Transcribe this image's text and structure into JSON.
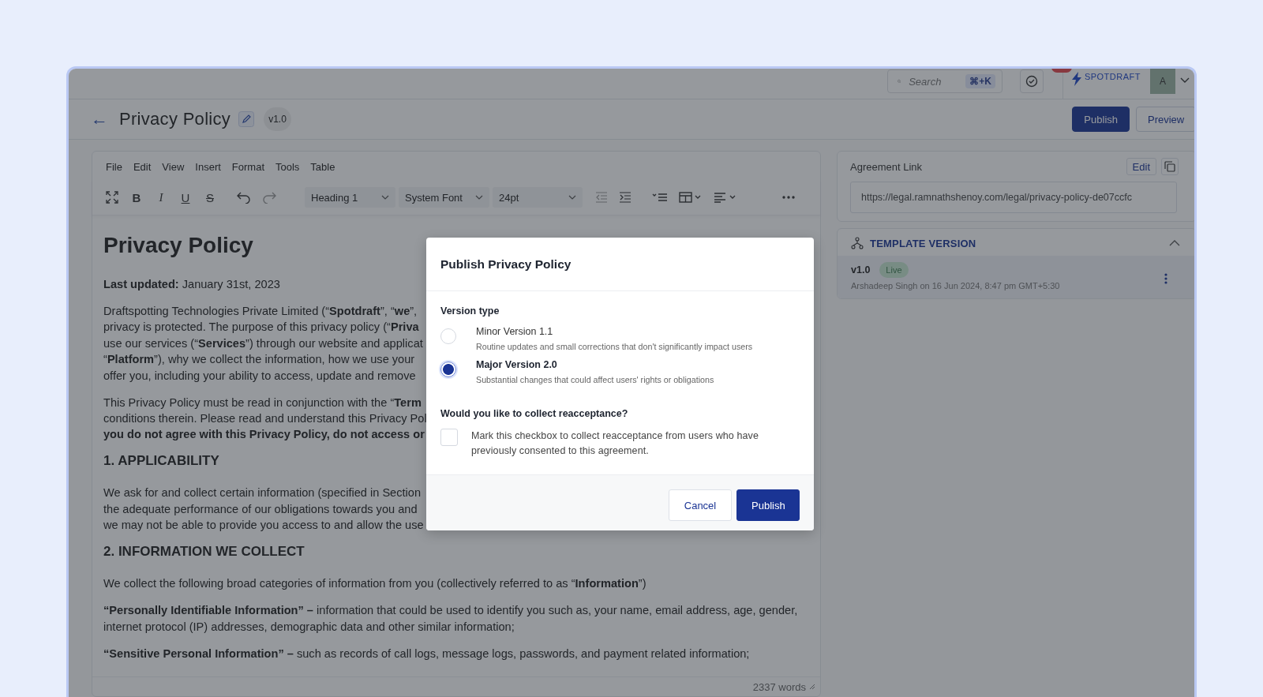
{
  "topbar": {
    "search": {
      "placeholder": "Search",
      "shortcut": "⌘+K"
    },
    "logo": "SPOTDRAFT",
    "avatar": "A"
  },
  "header": {
    "back": "←",
    "title": "Privacy Policy",
    "version": "v1.0",
    "buttons": [
      {
        "label": "Publish",
        "kind": "primary"
      },
      {
        "label": "Preview",
        "kind": "secondary"
      }
    ]
  },
  "editor": {
    "menu": [
      "File",
      "Edit",
      "View",
      "Insert",
      "Format",
      "Tools",
      "Table"
    ],
    "format_buttons": [
      {
        "label": "B",
        "kind": "bold"
      },
      {
        "label": "I",
        "kind": "italic"
      },
      {
        "label": "U",
        "kind": "underline"
      },
      {
        "label": "S",
        "kind": "strike"
      }
    ],
    "dropdowns": [
      {
        "value": "Heading 1",
        "kind": "style"
      },
      {
        "value": "System Font",
        "kind": "font"
      },
      {
        "value": "24pt",
        "kind": "size"
      }
    ],
    "document": [
      {
        "kind": "title",
        "text": "Privacy Policy"
      },
      {
        "kind": "paragraph",
        "text": "**Last updated:** January 31st, 2023"
      },
      {
        "kind": "lines",
        "lines": [
          "Draftspotting Technologies Private Limited (“**Spotdraft**”, “**we**”,",
          "privacy is protected. The purpose of this privacy policy (“**Priva**",
          "use our services (“**Services**”) through our website and applicat",
          "“**Platform**”), why we collect the information, how we use your",
          "offer you, including your ability to access, update and remove"
        ]
      },
      {
        "kind": "lines",
        "lines": [
          "This Privacy Policy must be read in conjunction with the “**Term**",
          "conditions therein. Please read and understand this Privacy Pol",
          "**you do not agree with this Privacy Policy, do not access or**"
        ]
      },
      {
        "kind": "heading",
        "text": "1. APPLICABILITY"
      },
      {
        "kind": "lines",
        "lines": [
          "We ask for and collect certain information (specified in Section",
          "the adequate performance of our obligations towards you and",
          "we may not be able to provide you access to and allow the use"
        ]
      },
      {
        "kind": "heading",
        "text": "2. INFORMATION WE COLLECT"
      },
      {
        "kind": "paragraph",
        "text": "We collect the following broad categories of information from you (collectively referred to as “**Information**”)"
      },
      {
        "kind": "paragraph",
        "text": "**“Personally Identifiable Information” –** information that could be used to identify you such as, your name, email address, age, gender, internet protocol (IP) addresses, demographic data and other similar information;"
      },
      {
        "kind": "paragraph",
        "text": "**“Sensitive Personal Information” –** such as records of call logs, message logs, passwords, and payment related information;"
      }
    ],
    "word_count": "2337 words"
  },
  "sidebar": {
    "link": {
      "title": "Agreement Link",
      "edit": "Edit",
      "url": "https://legal.ramnathshenoy.com/legal/privacy-policy-de07ccfc"
    },
    "versions": {
      "title": "TEMPLATE VERSION",
      "expanded": true,
      "items": [
        {
          "version": "v1.0",
          "badge": "Live",
          "meta": "Arshadeep Singh on 16 Jun 2024, 8:47 pm GMT+5:30"
        }
      ]
    }
  },
  "modal": {
    "title": "Publish Privacy Policy",
    "section": "Version type",
    "options": [
      {
        "label": "Minor Version 1.1",
        "description": "Routine updates and small corrections that don't significantly impact users",
        "selected": false
      },
      {
        "label": "Major Version 2.0",
        "description": "Substantial changes that could affect users' rights or obligations",
        "selected": true
      }
    ],
    "question": "Would you like to collect reacceptance?",
    "reaccept": {
      "label": "Mark this checkbox to collect reacceptance from users who have previously consented to this agreement.",
      "checked": false
    },
    "buttons": [
      {
        "label": "Cancel",
        "kind": "secondary"
      },
      {
        "label": "Publish",
        "kind": "primary"
      }
    ]
  }
}
